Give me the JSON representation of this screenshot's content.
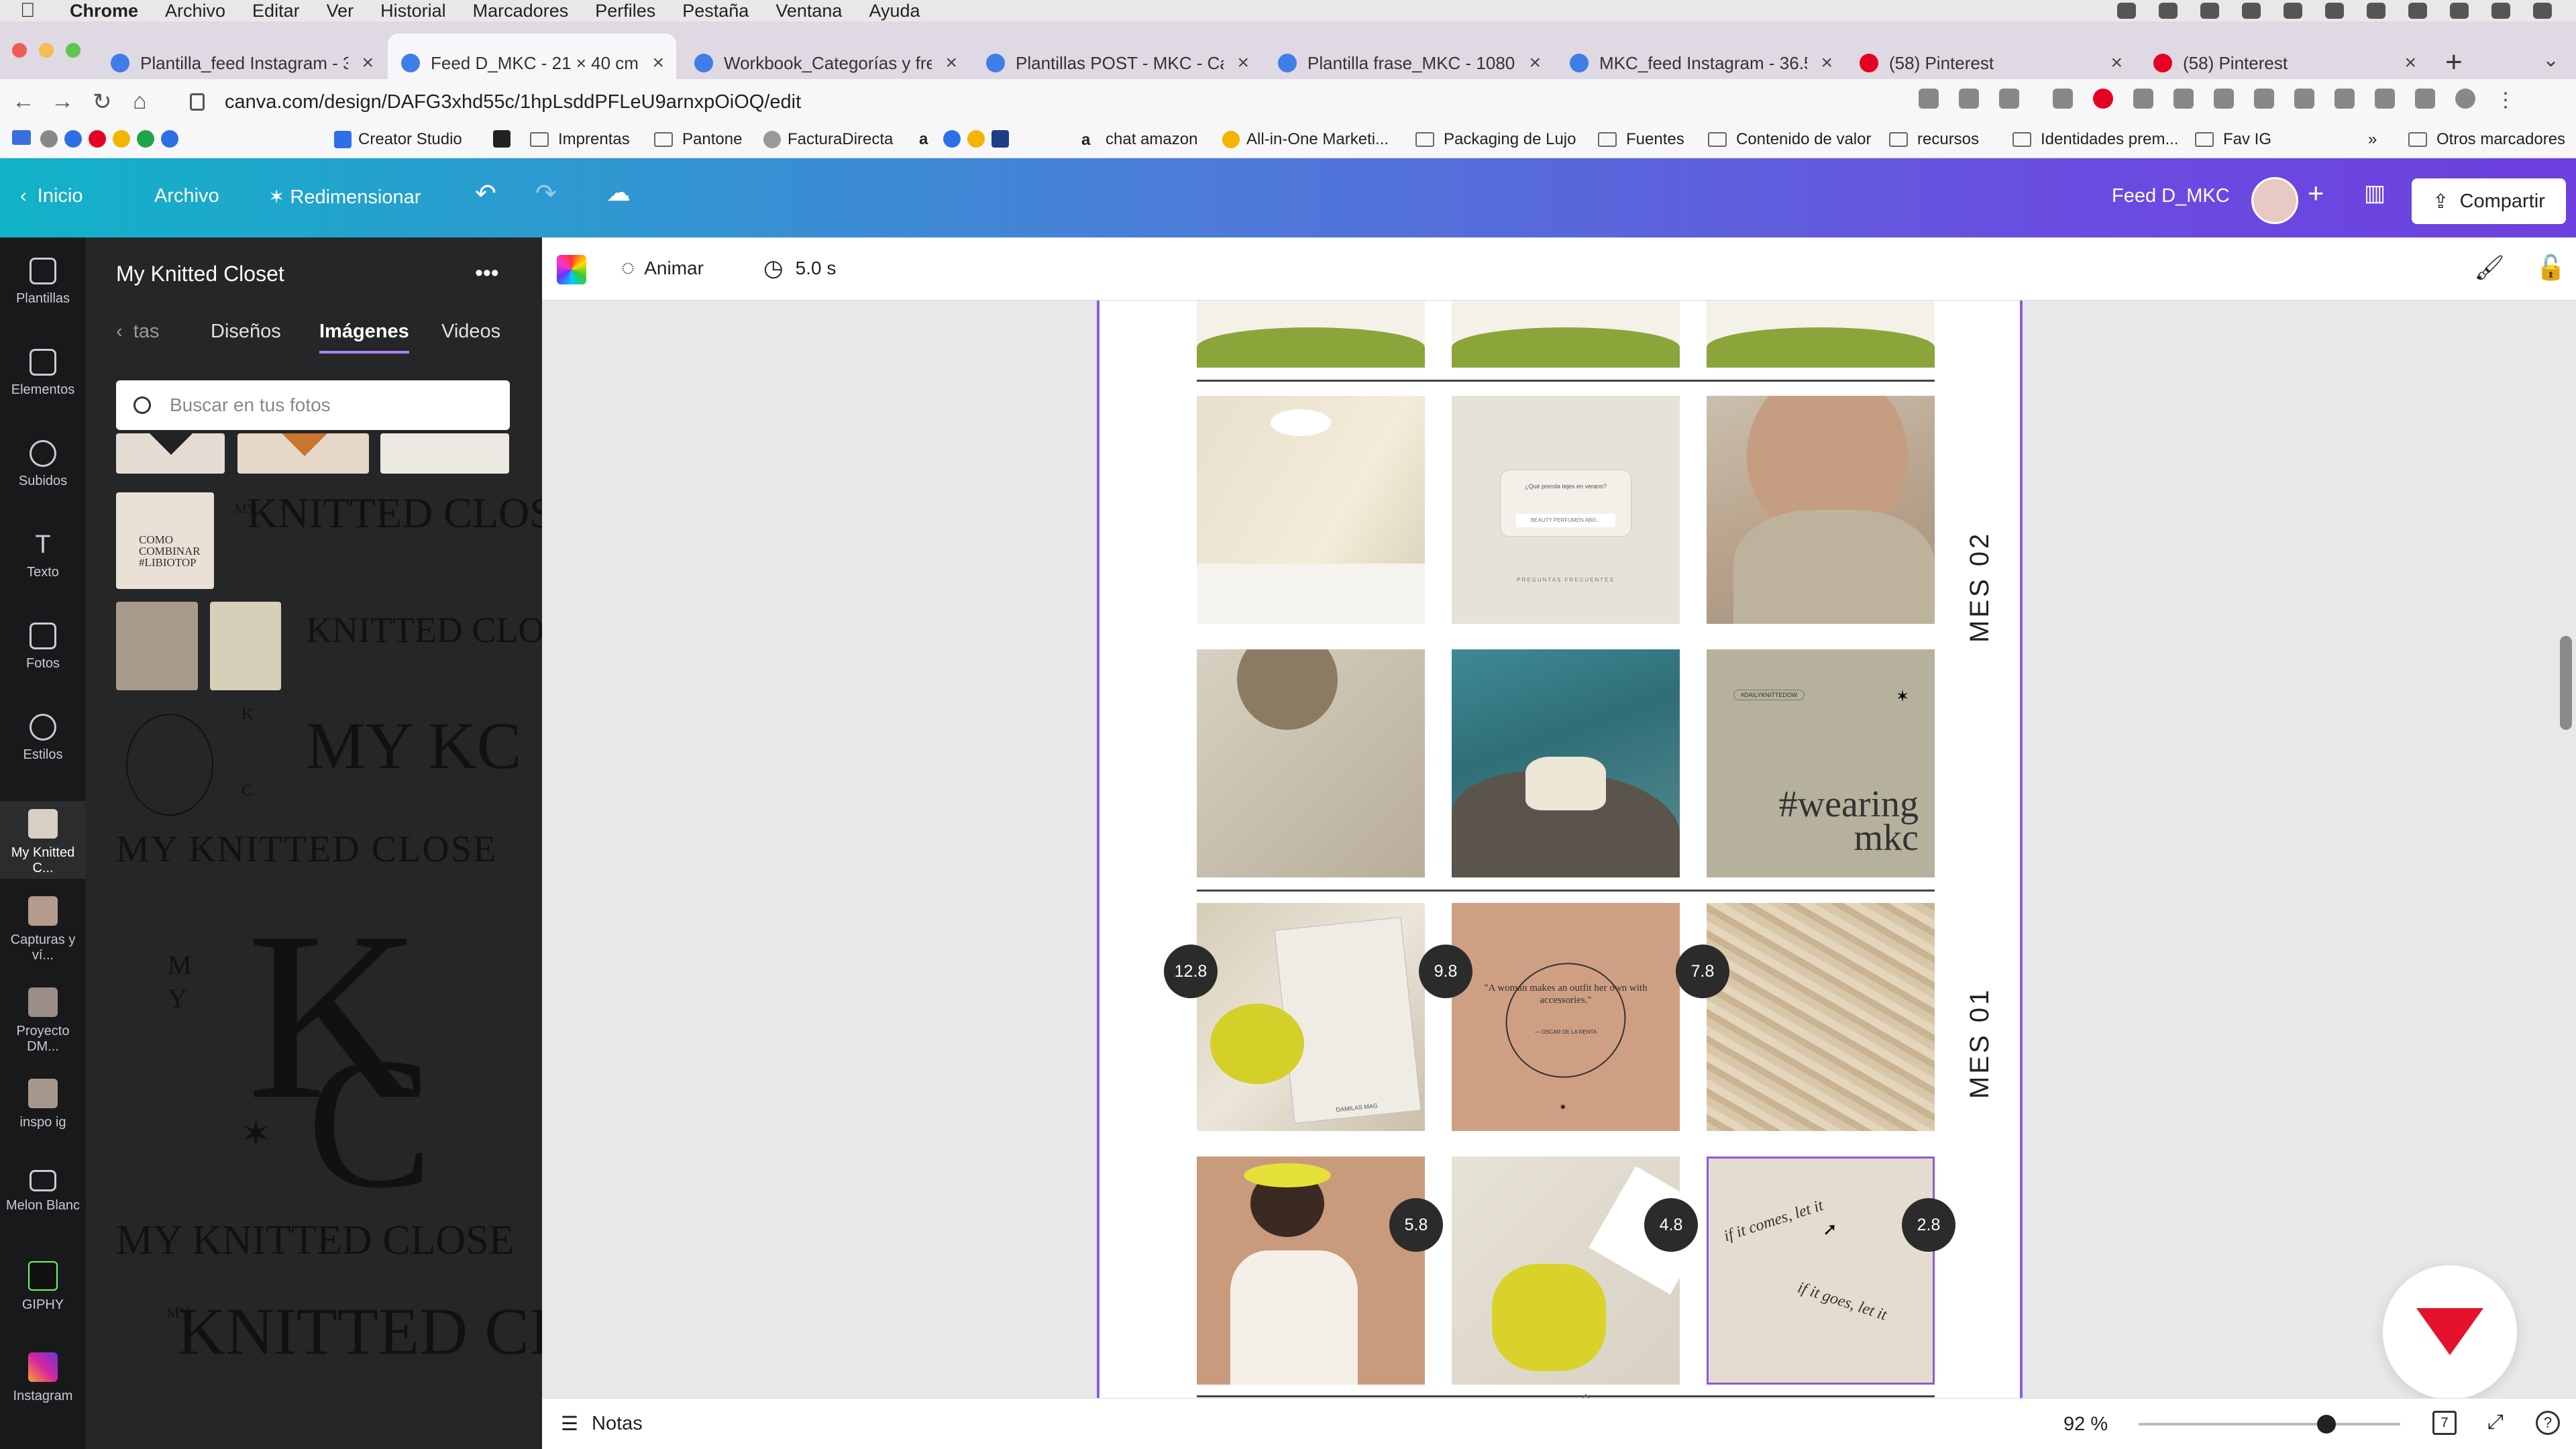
{
  "menubar": {
    "app": "Chrome",
    "items": [
      "Archivo",
      "Editar",
      "Ver",
      "Historial",
      "Marcadores",
      "Perfiles",
      "Pestaña",
      "Ventana",
      "Ayuda"
    ]
  },
  "tabs": [
    {
      "label": "Plantilla_feed Instagram - 36",
      "fav": "canva"
    },
    {
      "label": "Feed D_MKC - 21 × 40 cm",
      "fav": "canva"
    },
    {
      "label": "Workbook_Categorías y frecu",
      "fav": "canva"
    },
    {
      "label": "Plantillas POST - MKC - Canv",
      "fav": "canva"
    },
    {
      "label": "Plantilla frase_MKC - 1080 x 1",
      "fav": "canva"
    },
    {
      "label": "MKC_feed Instagram - 36.5 ×",
      "fav": "canva"
    },
    {
      "label": "(58) Pinterest",
      "fav": "pinterest"
    },
    {
      "label": "(58) Pinterest",
      "fav": "pinterest"
    }
  ],
  "address": {
    "url": "canva.com/design/DAFG3xhd55c/1hpLsddPFLeU9arnxpOiOQ/edit"
  },
  "bookmarks": {
    "creator_studio": "Creator Studio",
    "imprentas": "Imprentas",
    "pantone": "Pantone",
    "facturadirecta": "FacturaDirecta",
    "chat_amazon": "chat amazon",
    "allinone": "All-in-One Marketi...",
    "packaging": "Packaging de Lujo",
    "fuentes": "Fuentes",
    "contenido": "Contenido de valor",
    "recursos": "recursos",
    "identidades": "Identidades prem...",
    "favig": "Fav IG",
    "more": "»",
    "otros": "Otros marcadores"
  },
  "header": {
    "back": "Inicio",
    "file": "Archivo",
    "resize": "Redimensionar",
    "title": "Feed D_MKC",
    "share": "Compartir"
  },
  "toolbar": {
    "animate": "Animar",
    "duration": "5.0 s"
  },
  "rail": [
    {
      "label": "Plantillas"
    },
    {
      "label": "Elementos"
    },
    {
      "label": "Subidos"
    },
    {
      "label": "Texto"
    },
    {
      "label": "Fotos"
    },
    {
      "label": "Estilos"
    },
    {
      "label": "My Knitted C..."
    },
    {
      "label": "Capturas y ví..."
    },
    {
      "label": "Proyecto DM..."
    },
    {
      "label": "inspo ig"
    },
    {
      "label": "Melon Blanc"
    },
    {
      "label": "GIPHY"
    },
    {
      "label": "Instagram"
    }
  ],
  "panel": {
    "title": "My Knitted Closet",
    "tabs": [
      "tas",
      "Diseños",
      "Imágenes",
      "Videos"
    ],
    "search_placeholder": "Buscar en tus fotos",
    "thumb_text": "COMO COMBINAR #LIBIOTOP",
    "wordmarks": {
      "knitted_closet_1": "KNITTED CLOSET",
      "my": "MY",
      "knitted_closet_2": "KNITTED CLOSET",
      "my_kc": "MY KC",
      "k": "K",
      "c": "C",
      "wide": "MY KNITTED CLOSE",
      "big_k": "K",
      "big_my": "M Y",
      "big_c": "C",
      "wide2": "MY KNITTED CLOSE",
      "knitted3": "KNITTED CLOSET",
      "my3": "MY"
    }
  },
  "canvas": {
    "mes2": "MES 02",
    "mes1": "MES 01",
    "cell_texts": {
      "ph2": "¿Qué prenda tejes en verano?",
      "ph2_btn": "BEAUTY PERFUMEN ABO...",
      "ph2_foot": "PREGUNTAS FRECUENTES",
      "tag": "#DAILYKNITTEDOW",
      "wearing1": "#wearing",
      "wearing2": "mkc",
      "quote": "\"A woman makes an outfit her own with accessories.\"",
      "quote_by": "— OSCAR DE LA RENTA",
      "mag": "DAMILAS MAG",
      "comes": "if it comes, let it",
      "goes": "if it goes, let it"
    },
    "badges": [
      "12.8",
      "9.8",
      "7.8",
      "5.8",
      "4.8",
      "2.8"
    ]
  },
  "bottom": {
    "notes": "Notas",
    "zoom": "92 %",
    "pages": "7",
    "zoom_level": 0.92
  }
}
